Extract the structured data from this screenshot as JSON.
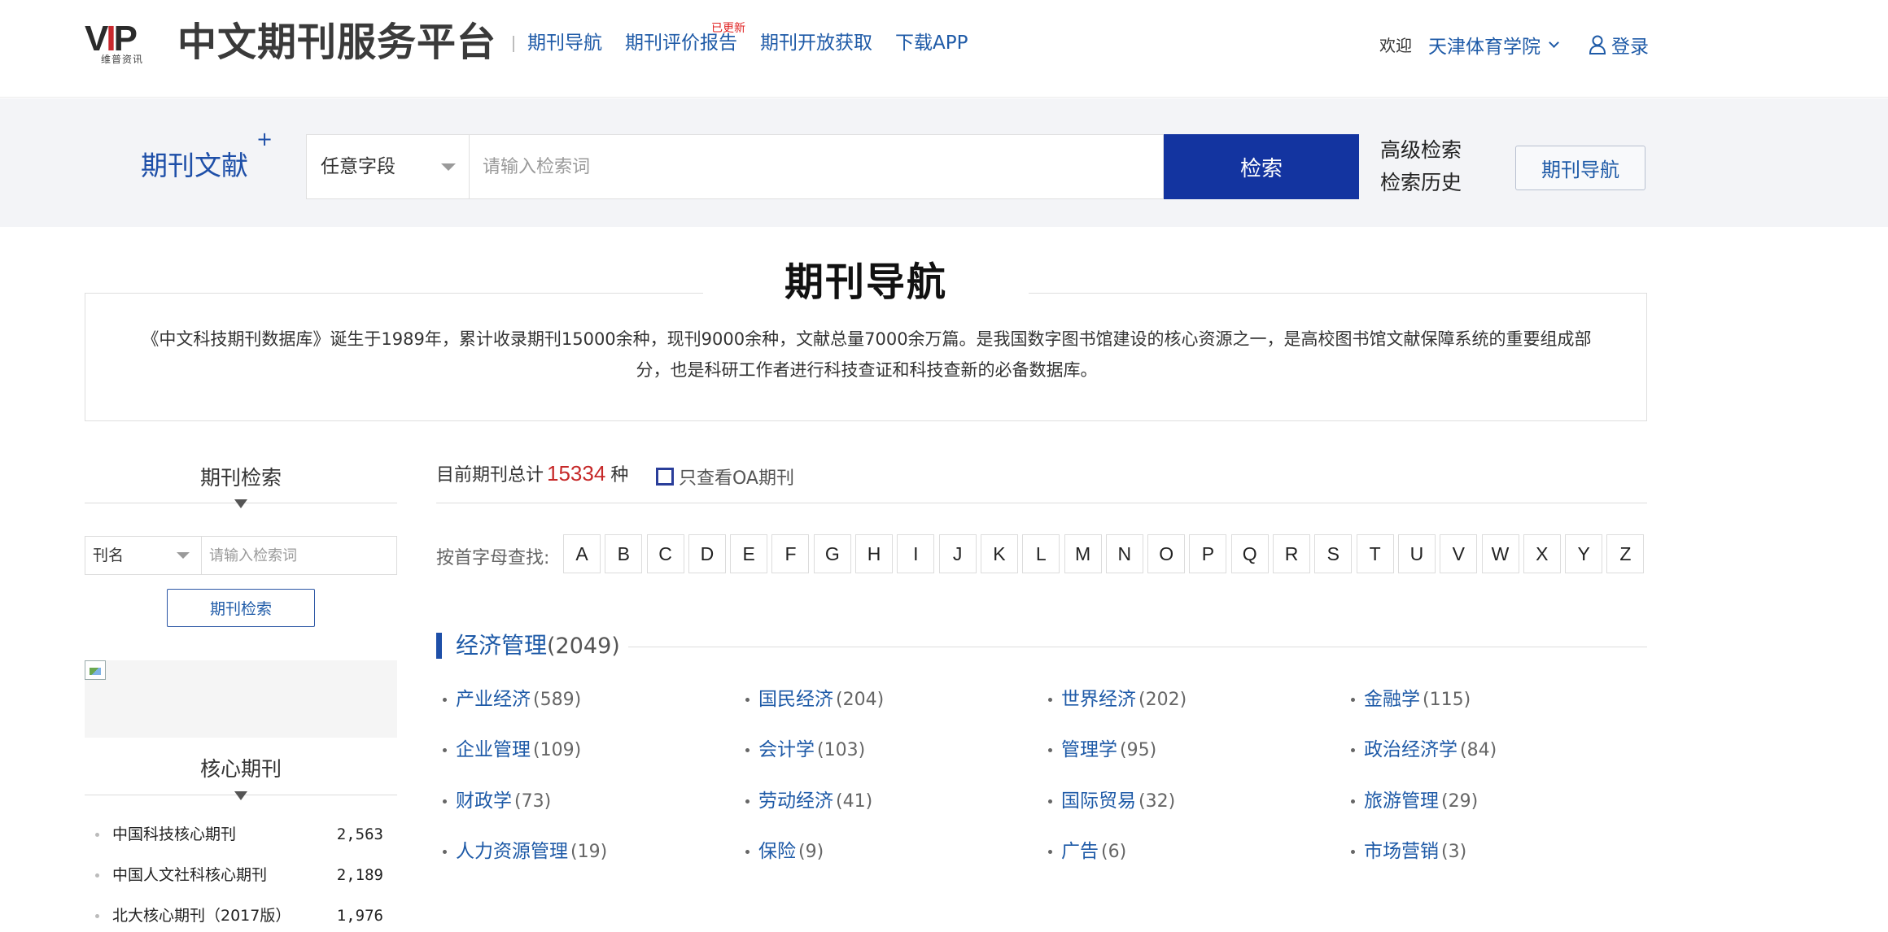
{
  "header": {
    "logo_text": "VIP",
    "logo_sub": "维普资讯",
    "site_title": "中文期刊服务平台",
    "nav": [
      {
        "label": "期刊导航"
      },
      {
        "label": "期刊评价报告",
        "badge": "已更新"
      },
      {
        "label": "期刊开放获取"
      },
      {
        "label": "下载APP"
      }
    ],
    "welcome": "欢迎",
    "institution": "天津体育学院",
    "login": "登录"
  },
  "search": {
    "scope_label": "期刊文献",
    "scope_plus": "+",
    "field": "任意字段",
    "placeholder": "请输入检索词",
    "button": "检索",
    "advanced": "高级检索",
    "history": "检索历史",
    "nav_button": "期刊导航"
  },
  "section": {
    "title": "期刊导航",
    "intro": "《中文科技期刊数据库》诞生于1989年，累计收录期刊15000余种，现刊9000余种，文献总量7000余万篇。是我国数字图书馆建设的核心资源之一，是高校图书馆文献保障系统的重要组成部分，也是科研工作者进行科技查证和科技查新的必备数据库。"
  },
  "sidebar": {
    "search_title": "期刊检索",
    "field": "刊名",
    "placeholder": "请输入检索词",
    "button": "期刊检索",
    "core_title": "核心期刊",
    "core": [
      {
        "name": "中国科技核心期刊",
        "count": "2,563"
      },
      {
        "name": "中国人文社科核心期刊",
        "count": "2,189"
      },
      {
        "name": "北大核心期刊（2017版）",
        "count": "1,976"
      }
    ]
  },
  "main": {
    "total_prefix": "目前期刊总计",
    "total": "15334",
    "total_suffix": "种",
    "oa_label": "只查看OA期刊",
    "alpha_label": "按首字母查找:",
    "letters": [
      "A",
      "B",
      "C",
      "D",
      "E",
      "F",
      "G",
      "H",
      "I",
      "J",
      "K",
      "L",
      "M",
      "N",
      "O",
      "P",
      "Q",
      "R",
      "S",
      "T",
      "U",
      "V",
      "W",
      "X",
      "Y",
      "Z"
    ],
    "category": {
      "name": "经济管理",
      "count": "(2049)",
      "subs": [
        {
          "name": "产业经济",
          "count": "(589)"
        },
        {
          "name": "国民经济",
          "count": "(204)"
        },
        {
          "name": "世界经济",
          "count": "(202)"
        },
        {
          "name": "金融学",
          "count": "(115)"
        },
        {
          "name": "企业管理",
          "count": "(109)"
        },
        {
          "name": "会计学",
          "count": "(103)"
        },
        {
          "name": "管理学",
          "count": "(95)"
        },
        {
          "name": "政治经济学",
          "count": "(84)"
        },
        {
          "name": "财政学",
          "count": "(73)"
        },
        {
          "name": "劳动经济",
          "count": "(41)"
        },
        {
          "name": "国际贸易",
          "count": "(32)"
        },
        {
          "name": "旅游管理",
          "count": "(29)"
        },
        {
          "name": "人力资源管理",
          "count": "(19)"
        },
        {
          "name": "保险",
          "count": "(9)"
        },
        {
          "name": "广告",
          "count": "(6)"
        },
        {
          "name": "市场营销",
          "count": "(3)"
        }
      ]
    }
  },
  "colors": {
    "primary": "#1334a0",
    "link": "#1e5aa7",
    "accent_red": "#c62828"
  }
}
